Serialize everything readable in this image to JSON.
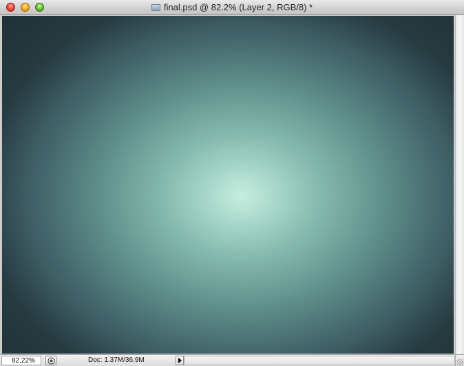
{
  "window": {
    "title": "final.psd @ 82.2% (Layer 2, RGB/8) *",
    "icons": {
      "close": "close-icon",
      "minimize": "minimize-icon",
      "zoom": "zoom-icon",
      "document": "document-icon"
    }
  },
  "canvas": {
    "description_colors": {
      "center": "#c8eee0",
      "edge": "#2c4148"
    }
  },
  "statusbar": {
    "zoom_value": "82.22%",
    "doc_info": "Doc: 1.37M/36.9M",
    "icons": {
      "status_menu": "preview-icon",
      "expand_arrow": "triangle-right-icon"
    }
  }
}
